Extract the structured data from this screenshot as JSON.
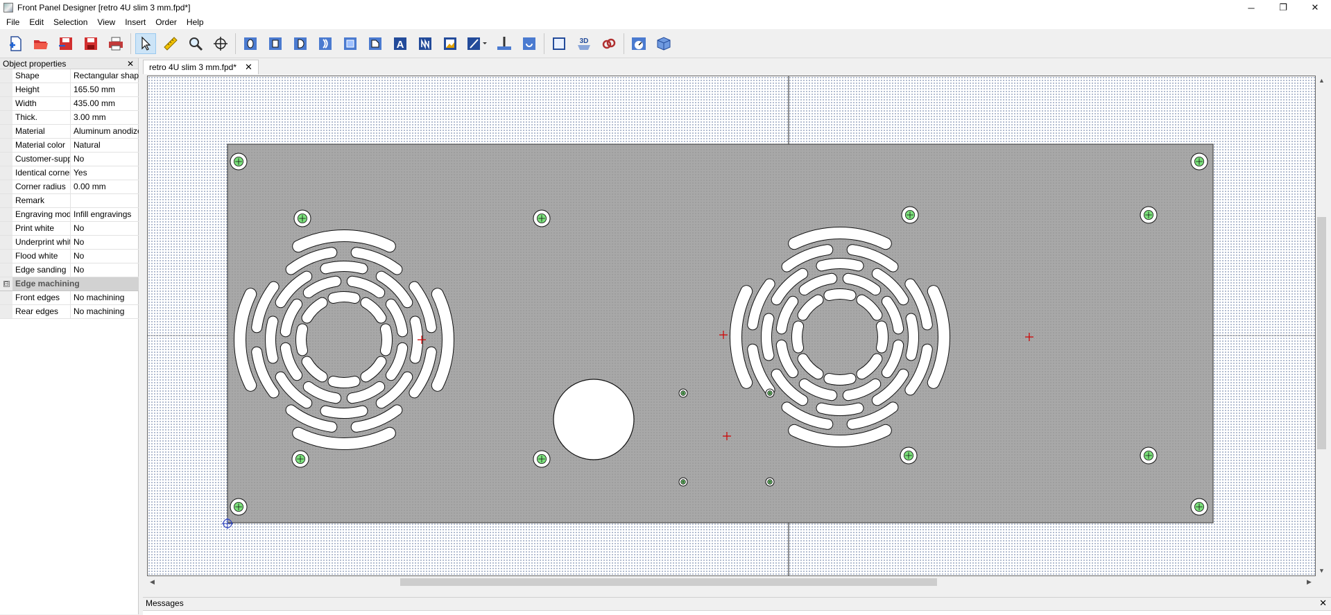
{
  "window": {
    "title": "Front Panel Designer [retro 4U slim 3 mm.fpd*]",
    "minimize": "─",
    "restore": "❐",
    "close": "✕"
  },
  "menu": [
    "File",
    "Edit",
    "Selection",
    "View",
    "Insert",
    "Order",
    "Help"
  ],
  "panel": {
    "title": "Object properties",
    "close": "✕",
    "rows": [
      {
        "name": "Shape",
        "value": "Rectangular shape"
      },
      {
        "name": "Height",
        "value": "165.50 mm"
      },
      {
        "name": "Width",
        "value": "435.00 mm"
      },
      {
        "name": "Thick.",
        "value": "3.00 mm"
      },
      {
        "name": "Material",
        "value": "Aluminum anodized"
      },
      {
        "name": "Material color",
        "value": "Natural"
      },
      {
        "name": "Customer-supplied",
        "value": "No"
      },
      {
        "name": "Identical corners",
        "value": "Yes"
      },
      {
        "name": "Corner radius",
        "value": "0.00 mm"
      },
      {
        "name": "Remark",
        "value": ""
      },
      {
        "name": "Engraving mode",
        "value": "Infill engravings"
      },
      {
        "name": "Print white",
        "value": "No"
      },
      {
        "name": "Underprint white",
        "value": "No"
      },
      {
        "name": "Flood white",
        "value": "No"
      },
      {
        "name": "Edge sanding",
        "value": "No"
      }
    ],
    "category": {
      "label": "Edge machining",
      "expander": "⊟"
    },
    "category_rows": [
      {
        "name": "Front edges",
        "value": "No machining"
      },
      {
        "name": "Rear edges",
        "value": "No machining"
      }
    ]
  },
  "tab": {
    "label": "retro 4U slim 3 mm.fpd*",
    "close": "✕"
  },
  "messages": {
    "title": "Messages",
    "close": "✕"
  },
  "scroll": {
    "up": "▲",
    "down": "▼",
    "left": "◀",
    "right": "▶"
  },
  "toolbar_text": {
    "text_tool": "A",
    "threed": "3D"
  },
  "colors": {
    "panel_fill": "#a8a8a8",
    "cutout_fill": "#ffffff",
    "screw_green": "#7be07b",
    "crosshair_red": "#d00000",
    "canvas_dots": "#7f8fb0"
  }
}
